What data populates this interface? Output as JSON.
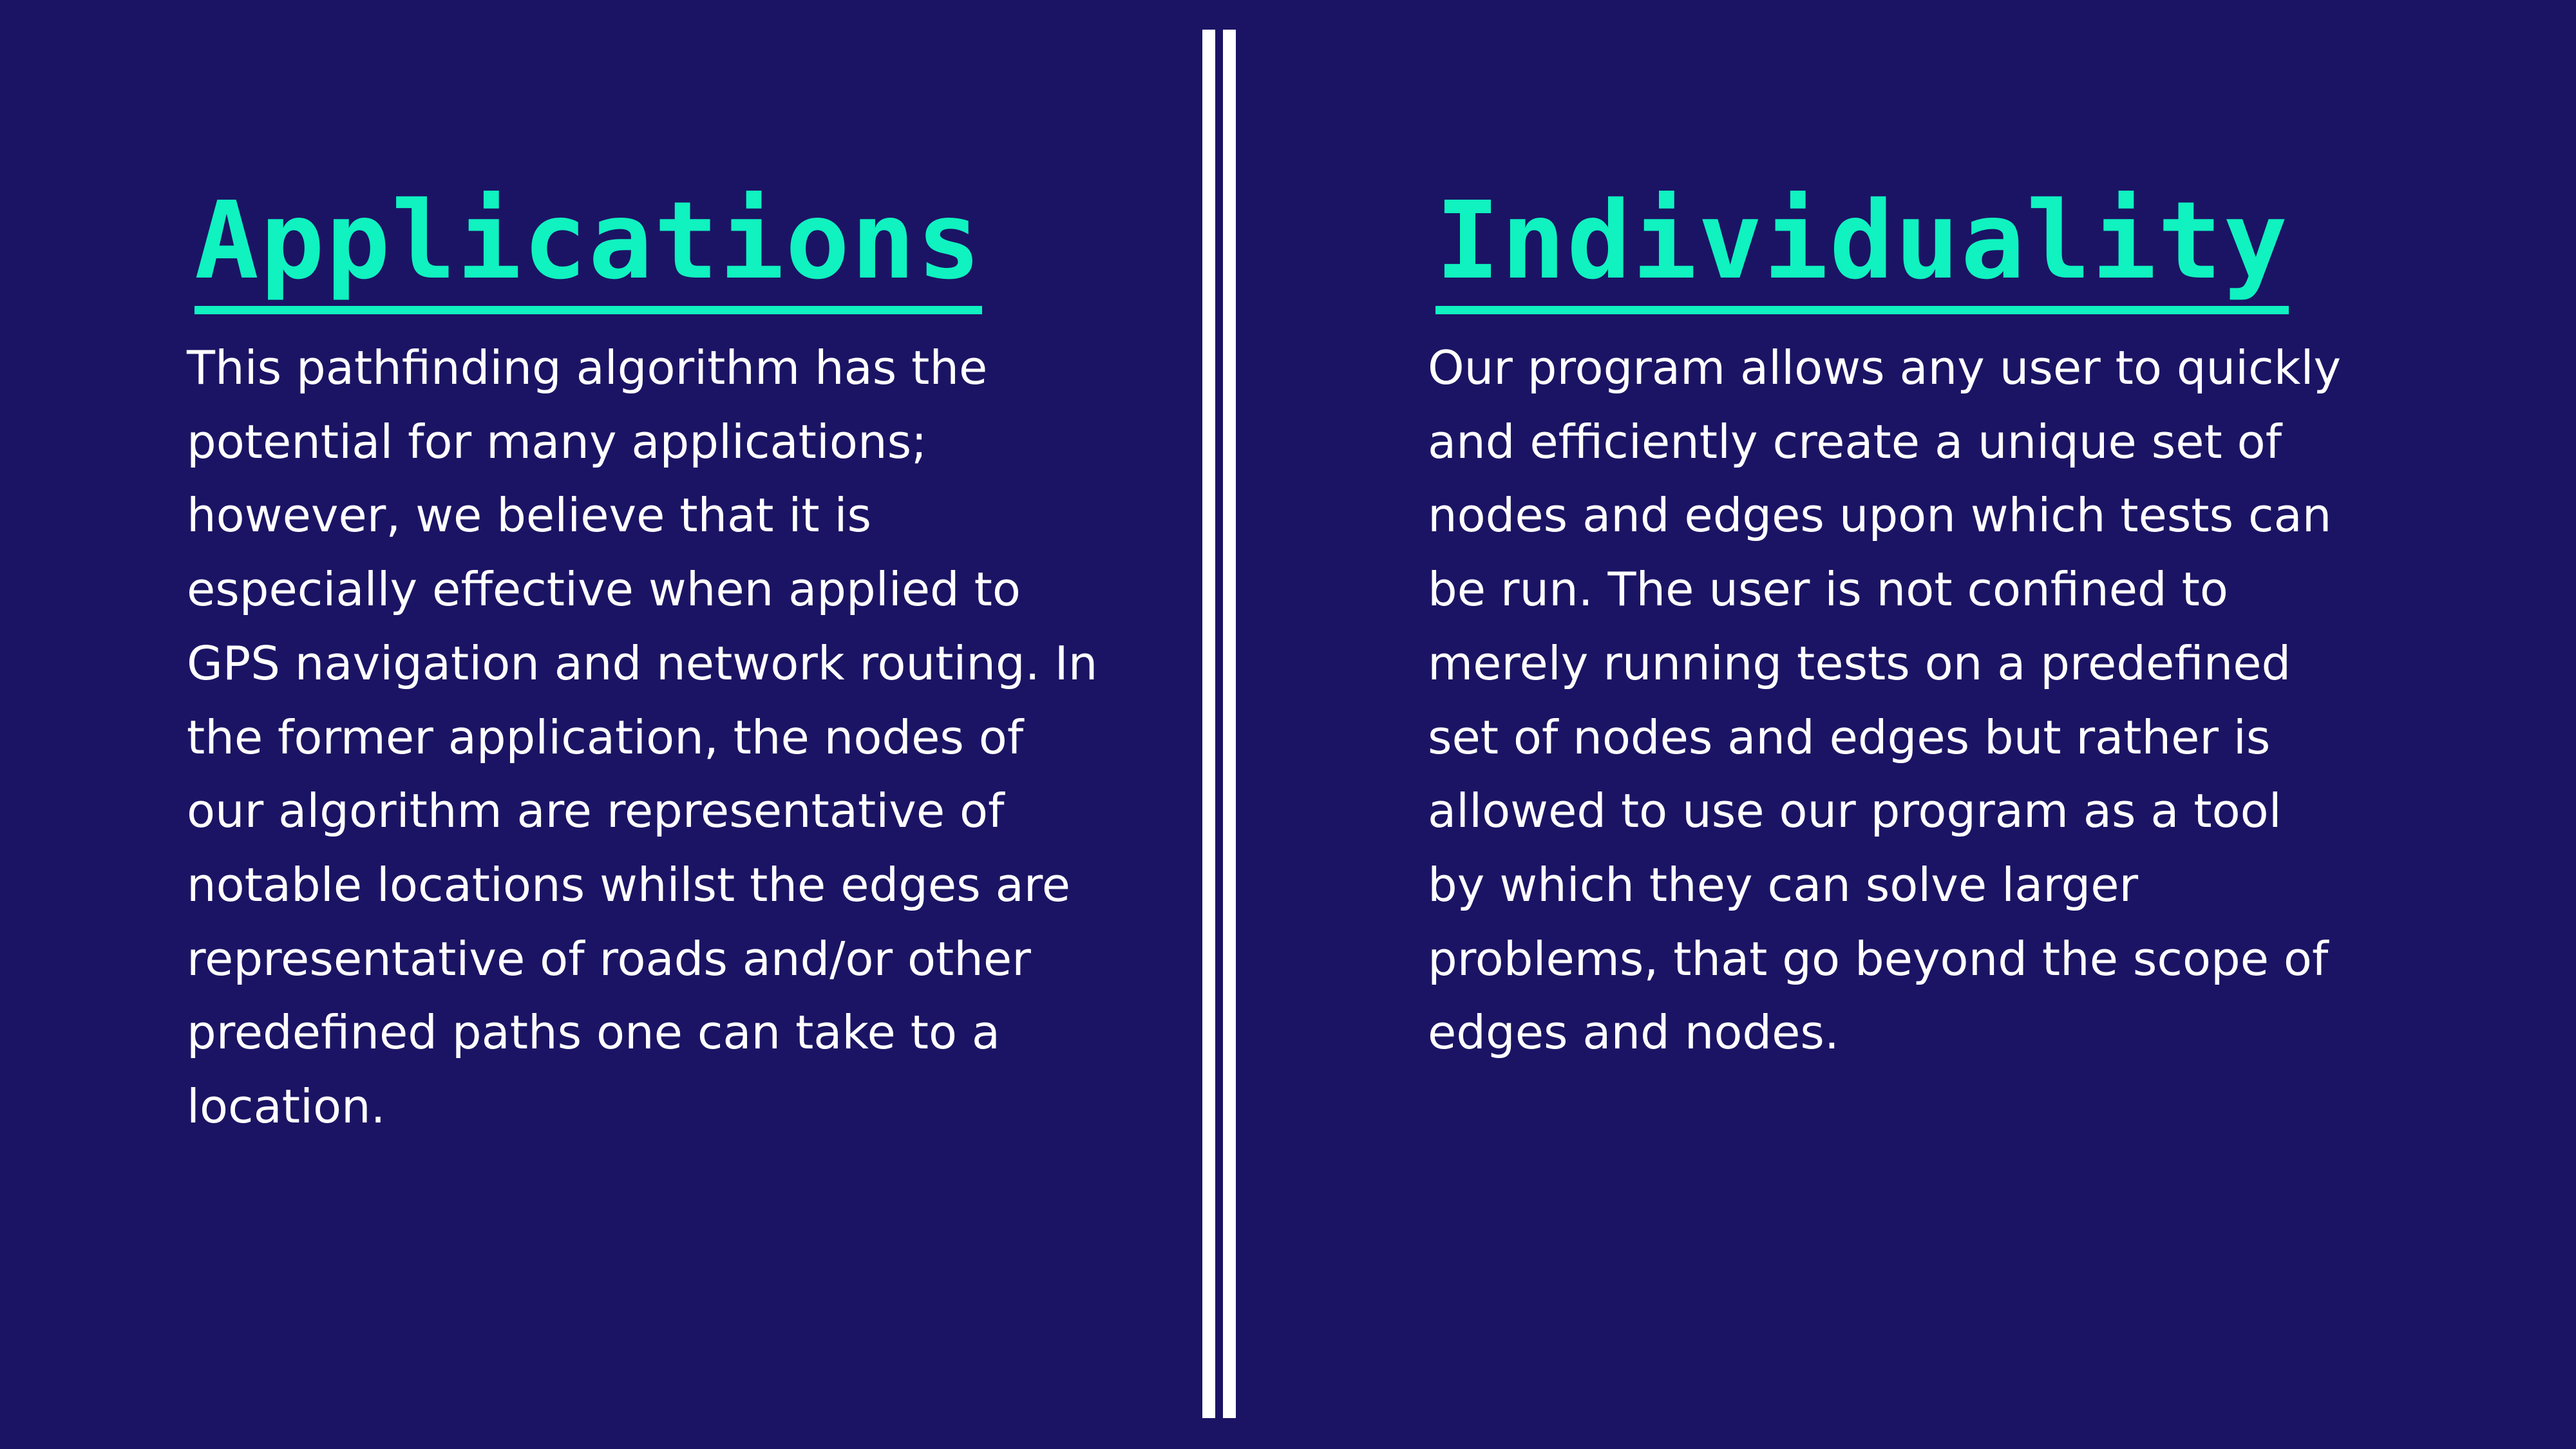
{
  "colors": {
    "background": "#1b1464",
    "heading": "#10f2c0",
    "text": "#ffffff",
    "divider": "#ffffff"
  },
  "left": {
    "heading": "Applications",
    "body": "This pathfinding algorithm has the potential for many applications; however, we believe that it is especially effective when applied to GPS navigation and network routing. In the former application, the nodes of our algorithm are representative of notable locations whilst the edges are representative of roads and/or other predefined paths one can take to a location."
  },
  "right": {
    "heading": "Individuality",
    "body": "Our program allows any user to quickly and efficiently create a unique set of nodes and edges upon which tests can be run. The user is not confined to merely running tests on a predefined set of nodes and edges but rather is allowed to use our program as a tool by which they can solve larger problems, that go beyond the scope of edges and nodes."
  }
}
